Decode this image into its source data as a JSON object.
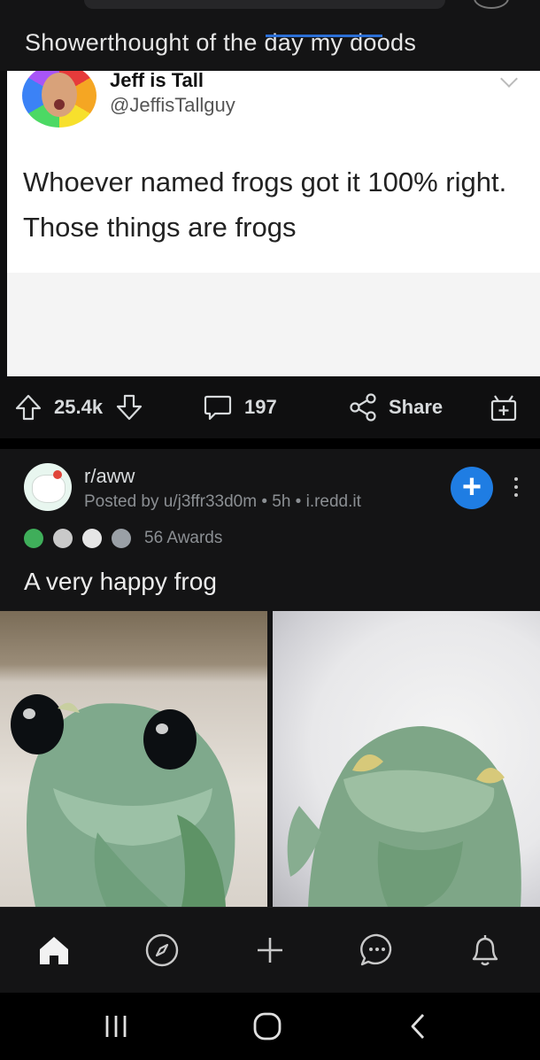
{
  "post1": {
    "title": "Showerthought of the day my doods",
    "tweet": {
      "name": "Jeff is Tall",
      "handle": "@JeffisTallguy",
      "text": "Whoever named frogs got it 100% right. Those things are frogs"
    },
    "actions": {
      "upvotes": "25.4k",
      "comments": "197",
      "share": "Share"
    }
  },
  "post2": {
    "subreddit": "r/aww",
    "meta": "Posted by u/j3ffr33d0m • 5h • i.redd.it",
    "awards": "56 Awards",
    "title": "A very happy frog",
    "join_label": "+"
  },
  "colors": {
    "accent_blue": "#1f7de3",
    "background": "#0f0f10",
    "card": "#141415"
  },
  "icons": {
    "bottom_nav": [
      "home-icon",
      "discover-icon",
      "create-post-icon",
      "chat-icon",
      "notifications-icon"
    ],
    "system_nav": [
      "recent-apps-icon",
      "home-circle-icon",
      "back-icon"
    ]
  }
}
